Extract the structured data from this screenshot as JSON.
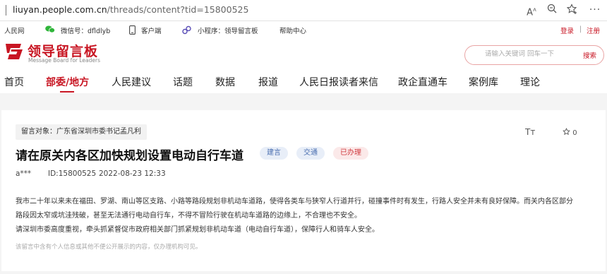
{
  "browser": {
    "url_host": "liuyan.people.com.cn",
    "url_path": "/threads/content?tid=15800525"
  },
  "topbar": {
    "people": "人民网",
    "wechat": "微信号：dfldlyb",
    "client": "客户端",
    "miniprogram": "小程序：领导留言板",
    "help": "帮助中心",
    "login": "登录",
    "divider": "|",
    "register": "注册"
  },
  "header": {
    "logo_cn": "领导留言板",
    "logo_en": "Message Board for Leaders",
    "search_placeholder": "请输入关键词 回车一下",
    "search_button": "搜索"
  },
  "nav": {
    "items": [
      "首页",
      "部委/地方",
      "人民建议",
      "话题",
      "数据",
      "报道",
      "人民日报读者来信",
      "政企直通车",
      "案例库",
      "理论"
    ],
    "active_index": 1
  },
  "post": {
    "target": "留言对象：广东省深圳市委书记孟凡利",
    "font_tool": "Tт",
    "star_count": "0",
    "title": "请在原关内各区加快规划设置电动自行车道",
    "tags": [
      "建言",
      "交通",
      "已办理"
    ],
    "author": "a***",
    "id": "ID:15800525",
    "date": "2022-08-23 12:33",
    "body_line1": "我市二十年以来未在福田、罗湖、南山等区支路、小路等路段规划非机动车道路，使得各类车与狭窄人行道并行，碰撞事件时有发生，行路人安全并未有良好保障。而关内各区部分",
    "body_line2": "路段因太窄或坑洼残破，甚至无法通行电动自行车，不得不冒险行驶在机动车道路的边缘上，不合理也不安全。",
    "body_line3": "请深圳市委高度重视，牵头抓紧督促市政府相关部门抓紧规划非机动车道（电动自行车道），保障行人和骑车人安全。",
    "notice": "该留言中含有个人信息或其他不便公开展示的内容，仅办理机构可见。"
  },
  "colors": {
    "brand_red": "#c81623",
    "tag_blue_bg": "#e8eef8",
    "tag_blue_text": "#4a6fb0",
    "tag_red_bg": "#fbe9e9",
    "tag_red_text": "#d0393e"
  }
}
